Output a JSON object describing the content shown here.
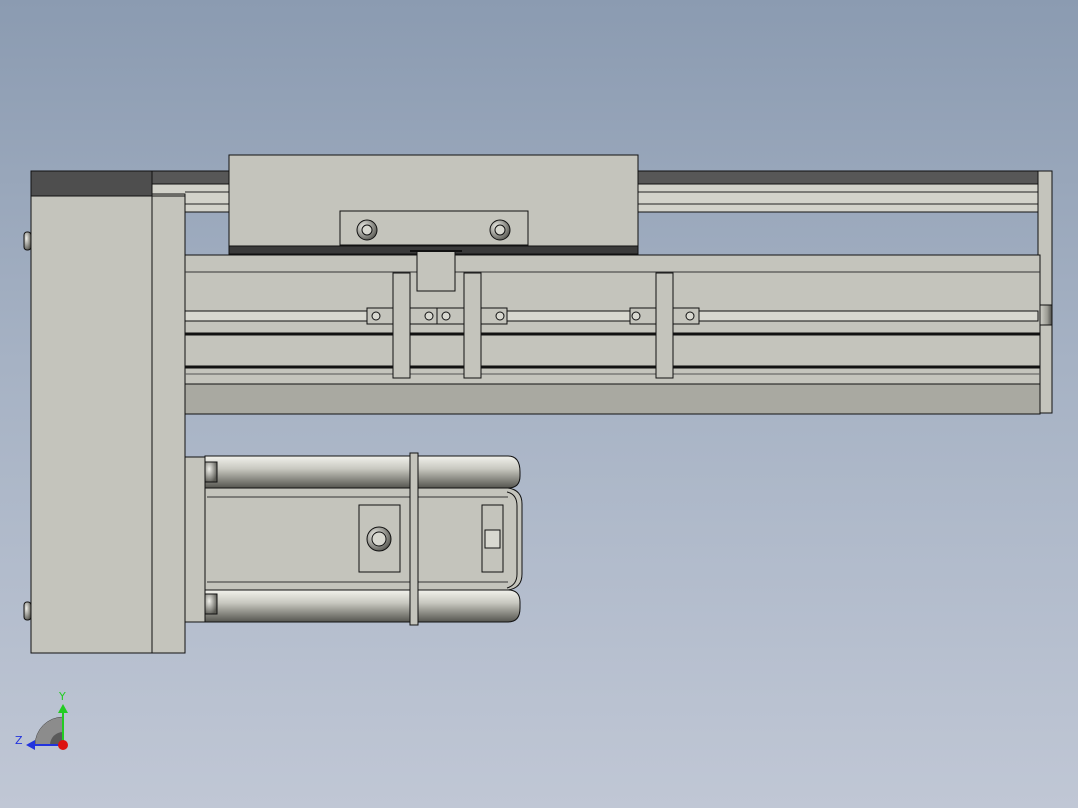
{
  "viewport": {
    "background_top": "#8b9bb1",
    "background_bottom": "#c0c7d5"
  },
  "model": {
    "body_color": "#c4c4bc",
    "shadow_color": "#a4a49c",
    "edge_color": "#111111",
    "dark_cap_color": "#4c4c4c"
  },
  "triad": {
    "y_label": "Y",
    "z_label": "Z",
    "y_color": "#22cc22",
    "z_color": "#2233dd",
    "origin_color": "#dd1111"
  }
}
